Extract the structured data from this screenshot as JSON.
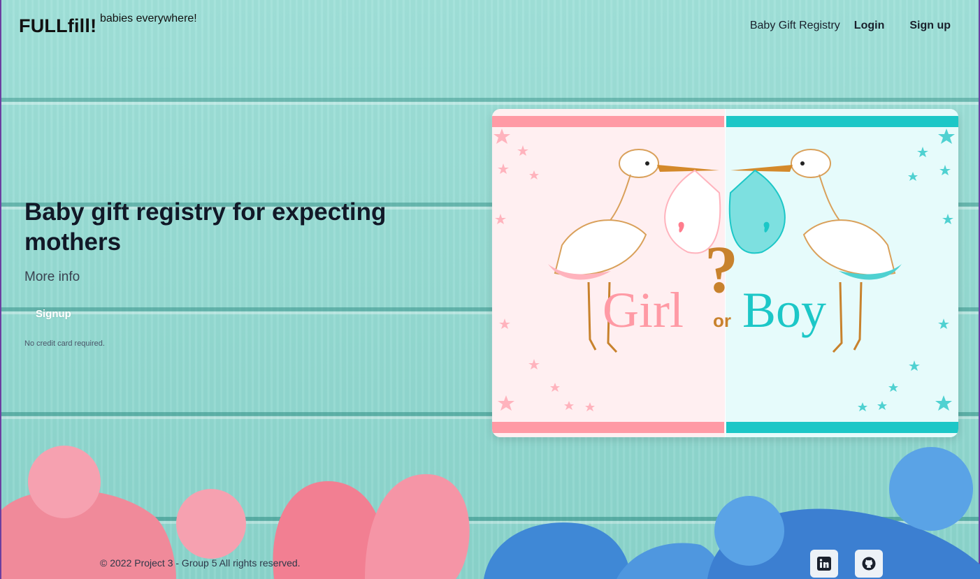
{
  "header": {
    "brand": "FULLfill!",
    "tagline": "babies everywhere!",
    "nav": {
      "registry": "Baby Gift Registry",
      "login": "Login",
      "signup": "Sign up"
    }
  },
  "hero": {
    "title": "Baby gift registry for expecting mothers",
    "more_info": "More info",
    "signup_button": "Signup",
    "note": "No credit card required."
  },
  "card": {
    "text_girl": "Girl",
    "text_or": "or",
    "text_boy": "Boy",
    "question_mark": "?",
    "colors": {
      "girl": "#ff9aa5",
      "boy": "#1cc7c7",
      "girl_bg": "#ffeff1",
      "boy_bg": "#e6fbfb",
      "beak": "#d4892a"
    }
  },
  "footer": {
    "copyright": "© 2022 Project 3 - Group 5 All rights reserved.",
    "social": [
      {
        "icon": "linkedin-icon"
      },
      {
        "icon": "github-icon"
      }
    ]
  }
}
